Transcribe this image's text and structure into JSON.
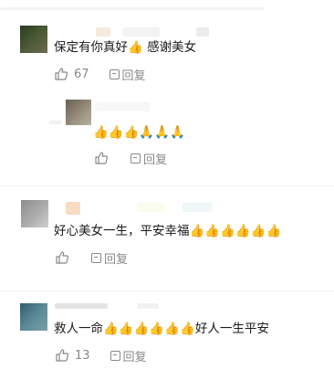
{
  "comments": [
    {
      "text": "保定有你真好👍 感谢美女",
      "like_count": "67",
      "reply_label": "回复",
      "avatar_color": "#3c4a2c"
    },
    {
      "text": "👍👍👍🙏🙏🙏",
      "reply_label": "回复",
      "avatar_color": "#8a8070",
      "nested": true
    },
    {
      "text": "好心美女一生，平安幸福👍👍👍👍👍👍",
      "reply_label": "回复",
      "avatar_color": "#9a9a9a"
    },
    {
      "text": "救人一命👍👍👍👍👍👍好人一生平安",
      "like_count": "13",
      "reply_label": "回复",
      "avatar_color": "#4a7a8a"
    }
  ],
  "icons": {
    "like": "thumbs-up-icon",
    "reply": "reply-icon"
  }
}
